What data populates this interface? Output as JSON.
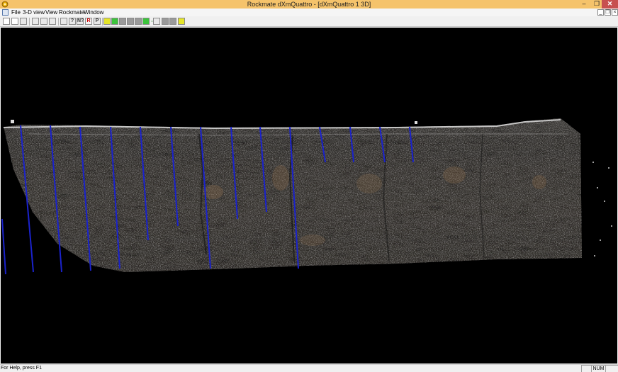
{
  "window": {
    "title": "Rockmate dXmQuattro - [dXmQuattro 1 3D]",
    "controls": {
      "minimize": "–",
      "maximize": "❐",
      "close": "✕"
    }
  },
  "menu": {
    "items": [
      "File",
      "3-D view",
      "View",
      "Rockmate",
      "Window"
    ],
    "mdi_controls": {
      "minimize": "_",
      "restore": "❐",
      "close": "×"
    }
  },
  "toolbar": {
    "buttons": [
      {
        "icon": "new-document-icon",
        "glyph": ""
      },
      {
        "icon": "open-folder-icon",
        "glyph": ""
      },
      {
        "icon": "save-icon",
        "glyph": ""
      },
      {
        "icon": "cut-icon",
        "glyph": ""
      },
      {
        "icon": "copy-icon",
        "glyph": ""
      },
      {
        "icon": "paste-icon",
        "glyph": ""
      },
      {
        "icon": "print-icon",
        "glyph": ""
      },
      {
        "icon": "about-icon",
        "glyph": "?"
      },
      {
        "icon": "context-help-icon",
        "glyph": "N?"
      },
      {
        "icon": "r-icon",
        "glyph": "R"
      },
      {
        "icon": "p-icon",
        "glyph": "P"
      },
      {
        "icon": "yellow-tool-icon",
        "glyph": ""
      },
      {
        "icon": "green-tool-icon",
        "glyph": ""
      },
      {
        "icon": "gray-tool-1-icon",
        "glyph": ""
      },
      {
        "icon": "gray-tool-2-icon",
        "glyph": ""
      },
      {
        "icon": "gray-tool-3-icon",
        "glyph": ""
      },
      {
        "icon": "green-check-icon",
        "glyph": ""
      },
      {
        "icon": "line-tool-icon",
        "glyph": ""
      },
      {
        "icon": "link-icon",
        "glyph": ""
      },
      {
        "icon": "gray-tool-4-icon",
        "glyph": ""
      },
      {
        "icon": "gray-tool-5-icon",
        "glyph": ""
      },
      {
        "icon": "yellow-frame-icon",
        "glyph": ""
      }
    ]
  },
  "viewport": {
    "description_icon": "point-cloud-3d-view",
    "background": "#000000",
    "survey_line_color": "#1a22cc"
  },
  "status": {
    "help": "For Help, press F1",
    "panes": [
      "",
      "NUM",
      ""
    ]
  }
}
